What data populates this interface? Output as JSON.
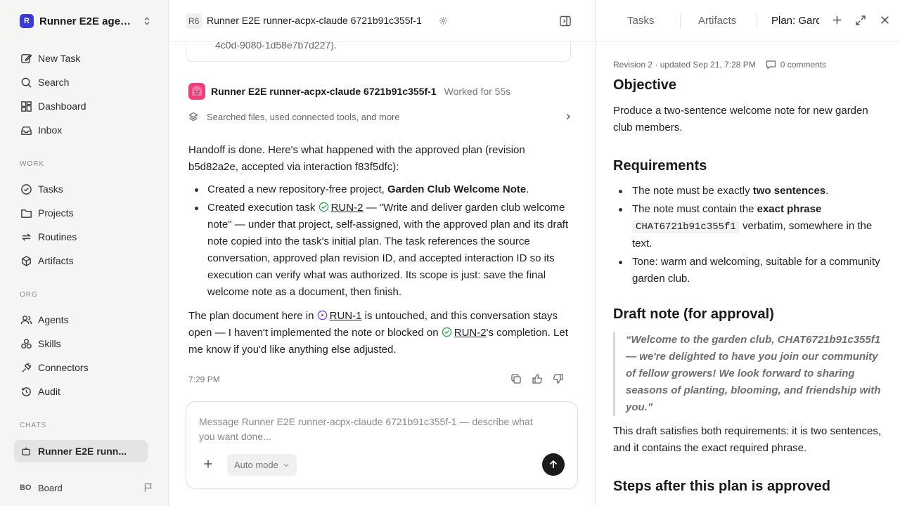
{
  "sidebar": {
    "workspace": {
      "logo": "R",
      "name": "Runner E2E agen..."
    },
    "top_items": [
      {
        "label": "New Task",
        "icon": "edit-icon"
      },
      {
        "label": "Search",
        "icon": "search-icon"
      },
      {
        "label": "Dashboard",
        "icon": "dashboard-icon"
      },
      {
        "label": "Inbox",
        "icon": "inbox-icon"
      }
    ],
    "work_label": "WORK",
    "work_items": [
      {
        "label": "Tasks",
        "icon": "check-circle-icon"
      },
      {
        "label": "Projects",
        "icon": "folder-icon"
      },
      {
        "label": "Routines",
        "icon": "repeat-icon"
      },
      {
        "label": "Artifacts",
        "icon": "box-icon"
      }
    ],
    "org_label": "ORG",
    "org_items": [
      {
        "label": "Agents",
        "icon": "users-icon"
      },
      {
        "label": "Skills",
        "icon": "skills-icon"
      },
      {
        "label": "Connectors",
        "icon": "plug-icon"
      },
      {
        "label": "Audit",
        "icon": "history-icon"
      }
    ],
    "chats_label": "CHATS",
    "chat_items": [
      {
        "label": "Runner E2E runn...",
        "icon": "bot-icon"
      }
    ],
    "board": {
      "initials": "BO",
      "label": "Board"
    }
  },
  "header": {
    "badge": "R6",
    "title": "Runner E2E runner-acpx-claude 6721b91c355f-1"
  },
  "previous_card_text": "4c0d-9080-1d58e7b7d227).",
  "agent": {
    "name": "Runner E2E runner-acpx-claude 6721b91c355f-1",
    "worked": "Worked for 55s",
    "tools_summary": "Searched files, used connected tools, and more"
  },
  "message": {
    "p1": "Handoff is done. Here's what happened with the approved plan (revision b5d82a2e, accepted via interaction f83f5dfc):",
    "b1_pre": "Created a new repository-free project, ",
    "b1_bold": "Garden Club Welcome Note",
    "b1_post": ".",
    "b2_pre": "Created execution task ",
    "b2_run": "RUN-2",
    "b2_post": " — \"Write and deliver garden club welcome note\" — under that project, self-assigned, with the approved plan and its draft note copied into the task's initial plan. The task references the source conversation, approved plan revision ID, and accepted interaction ID so its execution can verify what was authorized. Its scope is just: save the final welcome note as a document, then finish.",
    "p2_pre": "The plan document here in ",
    "p2_run1": "RUN-1",
    "p2_mid": " is untouched, and this conversation stays open — I haven't implemented the note or blocked on ",
    "p2_run2": "RUN-2",
    "p2_post": "'s completion. Let me know if you'd like anything else adjusted.",
    "time": "7:29 PM"
  },
  "composer": {
    "placeholder": "Message Runner E2E runner-acpx-claude 6721b91c355f-1 — describe what you want done...",
    "mode": "Auto mode"
  },
  "panel": {
    "tabs": {
      "tasks": "Tasks",
      "artifacts": "Artifacts",
      "plan": "Plan: Garden Club Welcome Note"
    },
    "revision": "Revision 2 · updated Sep 21, 7:28 PM",
    "comments": "0 comments",
    "objective_title": "Objective",
    "objective_text": "Produce a two-sentence welcome note for new garden club members.",
    "requirements_title": "Requirements",
    "req1_pre": "The note must be exactly ",
    "req1_bold": "two sentences",
    "req1_post": ".",
    "req2_pre": "The note must contain the ",
    "req2_bold": "exact phrase",
    "req2_code": "CHAT6721b91c355f1",
    "req2_post": " verbatim, somewhere in the text.",
    "req3": "Tone: warm and welcoming, suitable for a community garden club.",
    "draft_title": "Draft note (for approval)",
    "draft_quote": "“Welcome to the garden club, CHAT6721b91c355f1 — we're delighted to have you join our community of fellow growers! We look forward to sharing seasons of planting, blooming, and friendship with you.”",
    "draft_after": "This draft satisfies both requirements: it is two sentences, and it contains the exact required phrase.",
    "steps_title": "Steps after this plan is approved"
  },
  "colors": {
    "accent": "#3b3ad6",
    "agent_avatar": "#ec3f7b",
    "done_green": "#2e9e52",
    "active_purple": "#7b3fd6"
  }
}
